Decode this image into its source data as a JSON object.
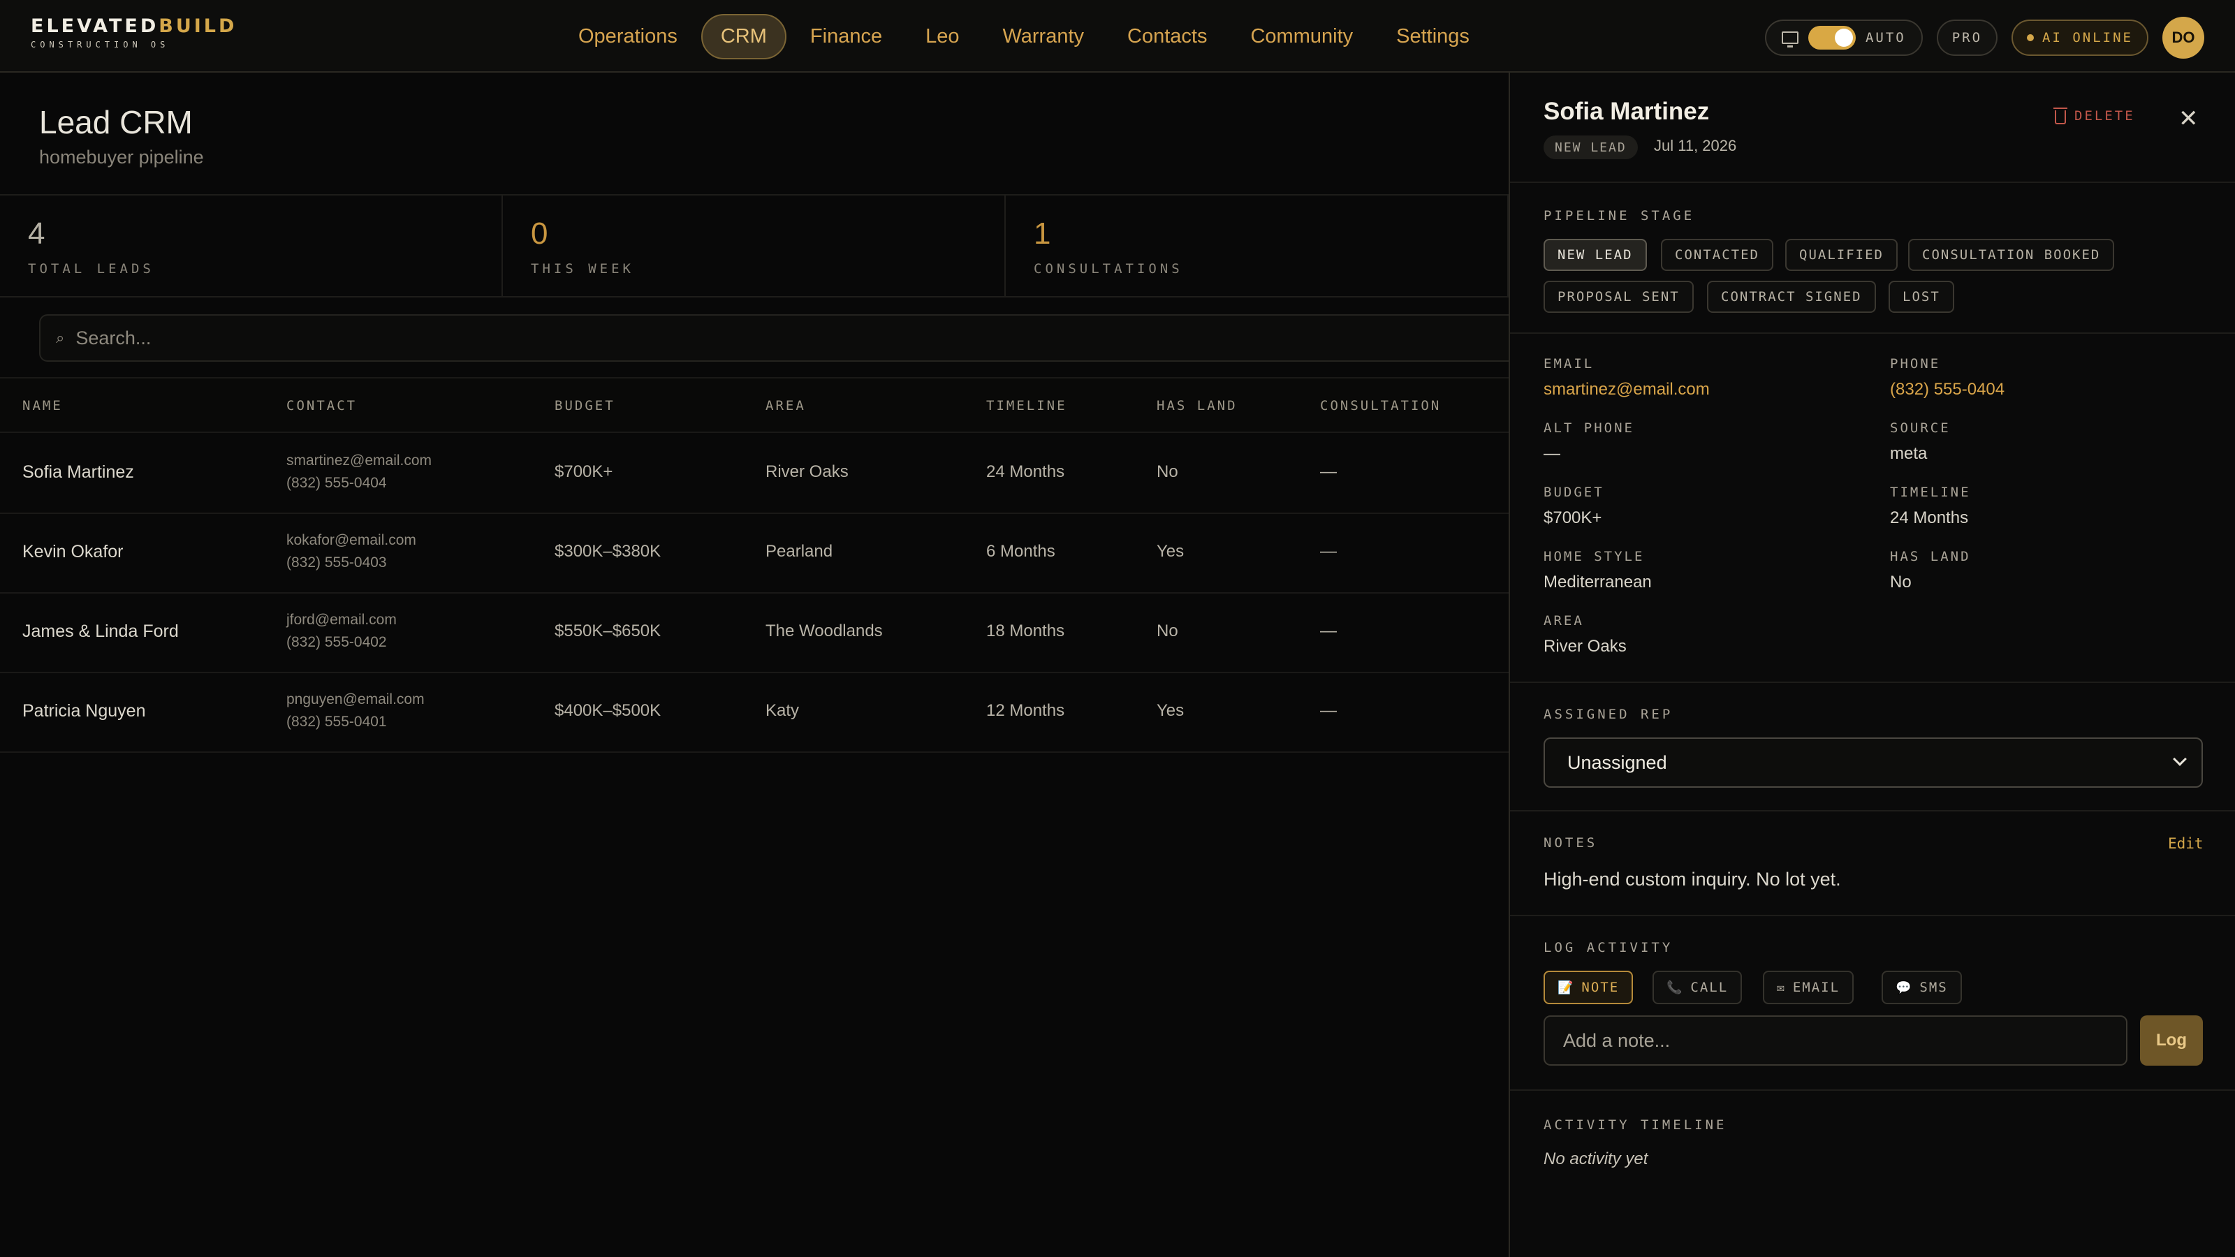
{
  "brand": {
    "name_a": "ELEVATED",
    "name_b": "BUILD",
    "sub": "CONSTRUCTION OS"
  },
  "nav": [
    {
      "label": "Operations"
    },
    {
      "label": "CRM",
      "active": true
    },
    {
      "label": "Finance"
    },
    {
      "label": "Leo"
    },
    {
      "label": "Warranty"
    },
    {
      "label": "Contacts"
    },
    {
      "label": "Community"
    },
    {
      "label": "Settings"
    }
  ],
  "tools": {
    "auto_label": "AUTO",
    "pro_label": "PRO",
    "ai_label": "AI ONLINE",
    "avatar_initials": "DO"
  },
  "page": {
    "title": "Lead CRM",
    "subtitle": "homebuyer pipeline"
  },
  "stats": [
    {
      "value": "4",
      "label": "TOTAL LEADS"
    },
    {
      "value": "0",
      "label": "THIS WEEK"
    },
    {
      "value": "1",
      "label": "CONSULTATIONS"
    }
  ],
  "search": {
    "placeholder": "Search..."
  },
  "table": {
    "headers": [
      "NAME",
      "CONTACT",
      "BUDGET",
      "AREA",
      "TIMELINE",
      "HAS LAND",
      "CONSULTATION"
    ],
    "rows": [
      {
        "name": "Sofia Martinez",
        "email": "smartinez@email.com",
        "phone": "(832) 555-0404",
        "budget": "$700K+",
        "area": "River Oaks",
        "timeline": "24 Months",
        "has_land": "No",
        "consultation": "—"
      },
      {
        "name": "Kevin Okafor",
        "email": "kokafor@email.com",
        "phone": "(832) 555-0403",
        "budget": "$300K–$380K",
        "area": "Pearland",
        "timeline": "6 Months",
        "has_land": "Yes",
        "consultation": "—"
      },
      {
        "name": "James & Linda Ford",
        "email": "jford@email.com",
        "phone": "(832) 555-0402",
        "budget": "$550K–$650K",
        "area": "The Woodlands",
        "timeline": "18 Months",
        "has_land": "No",
        "consultation": "—"
      },
      {
        "name": "Patricia Nguyen",
        "email": "pnguyen@email.com",
        "phone": "(832) 555-0401",
        "budget": "$400K–$500K",
        "area": "Katy",
        "timeline": "12 Months",
        "has_land": "Yes",
        "consultation": "—"
      }
    ]
  },
  "panel": {
    "name": "Sofia Martinez",
    "badge": "NEW LEAD",
    "date": "Jul 11, 2026",
    "delete_label": "DELETE",
    "close_glyph": "✕",
    "pipeline_label": "PIPELINE STAGE",
    "stages": [
      {
        "label": "NEW LEAD",
        "active": true
      },
      {
        "label": "CONTACTED"
      },
      {
        "label": "QUALIFIED"
      },
      {
        "label": "CONSULTATION BOOKED"
      },
      {
        "label": "PROPOSAL SENT"
      },
      {
        "label": "CONTRACT SIGNED"
      },
      {
        "label": "LOST"
      }
    ],
    "fields": {
      "email_label": "EMAIL",
      "email": "smartinez@email.com",
      "phone_label": "PHONE",
      "phone": "(832) 555-0404",
      "alt_phone_label": "ALT PHONE",
      "alt_phone": "—",
      "source_label": "SOURCE",
      "source": "meta",
      "budget_label": "BUDGET",
      "budget": "$700K+",
      "timeline_label": "TIMELINE",
      "timeline": "24 Months",
      "home_style_label": "HOME STYLE",
      "home_style": "Mediterranean",
      "has_land_label": "HAS LAND",
      "has_land": "No",
      "area_label": "AREA",
      "area": "River Oaks"
    },
    "assigned_label": "ASSIGNED REP",
    "assigned_value": "Unassigned",
    "notes_label": "NOTES",
    "notes_edit": "Edit",
    "notes_text": "High-end custom inquiry. No lot yet.",
    "log_label": "LOG ACTIVITY",
    "activity_types": [
      {
        "icon": "📝",
        "label": "NOTE",
        "active": true
      },
      {
        "icon": "📞",
        "label": "CALL"
      },
      {
        "icon": "✉",
        "label": "EMAIL"
      },
      {
        "icon": "💬",
        "label": "SMS"
      }
    ],
    "note_placeholder": "Add a note...",
    "log_button": "Log",
    "timeline_label": "ACTIVITY TIMELINE",
    "timeline_empty": "No activity yet"
  }
}
